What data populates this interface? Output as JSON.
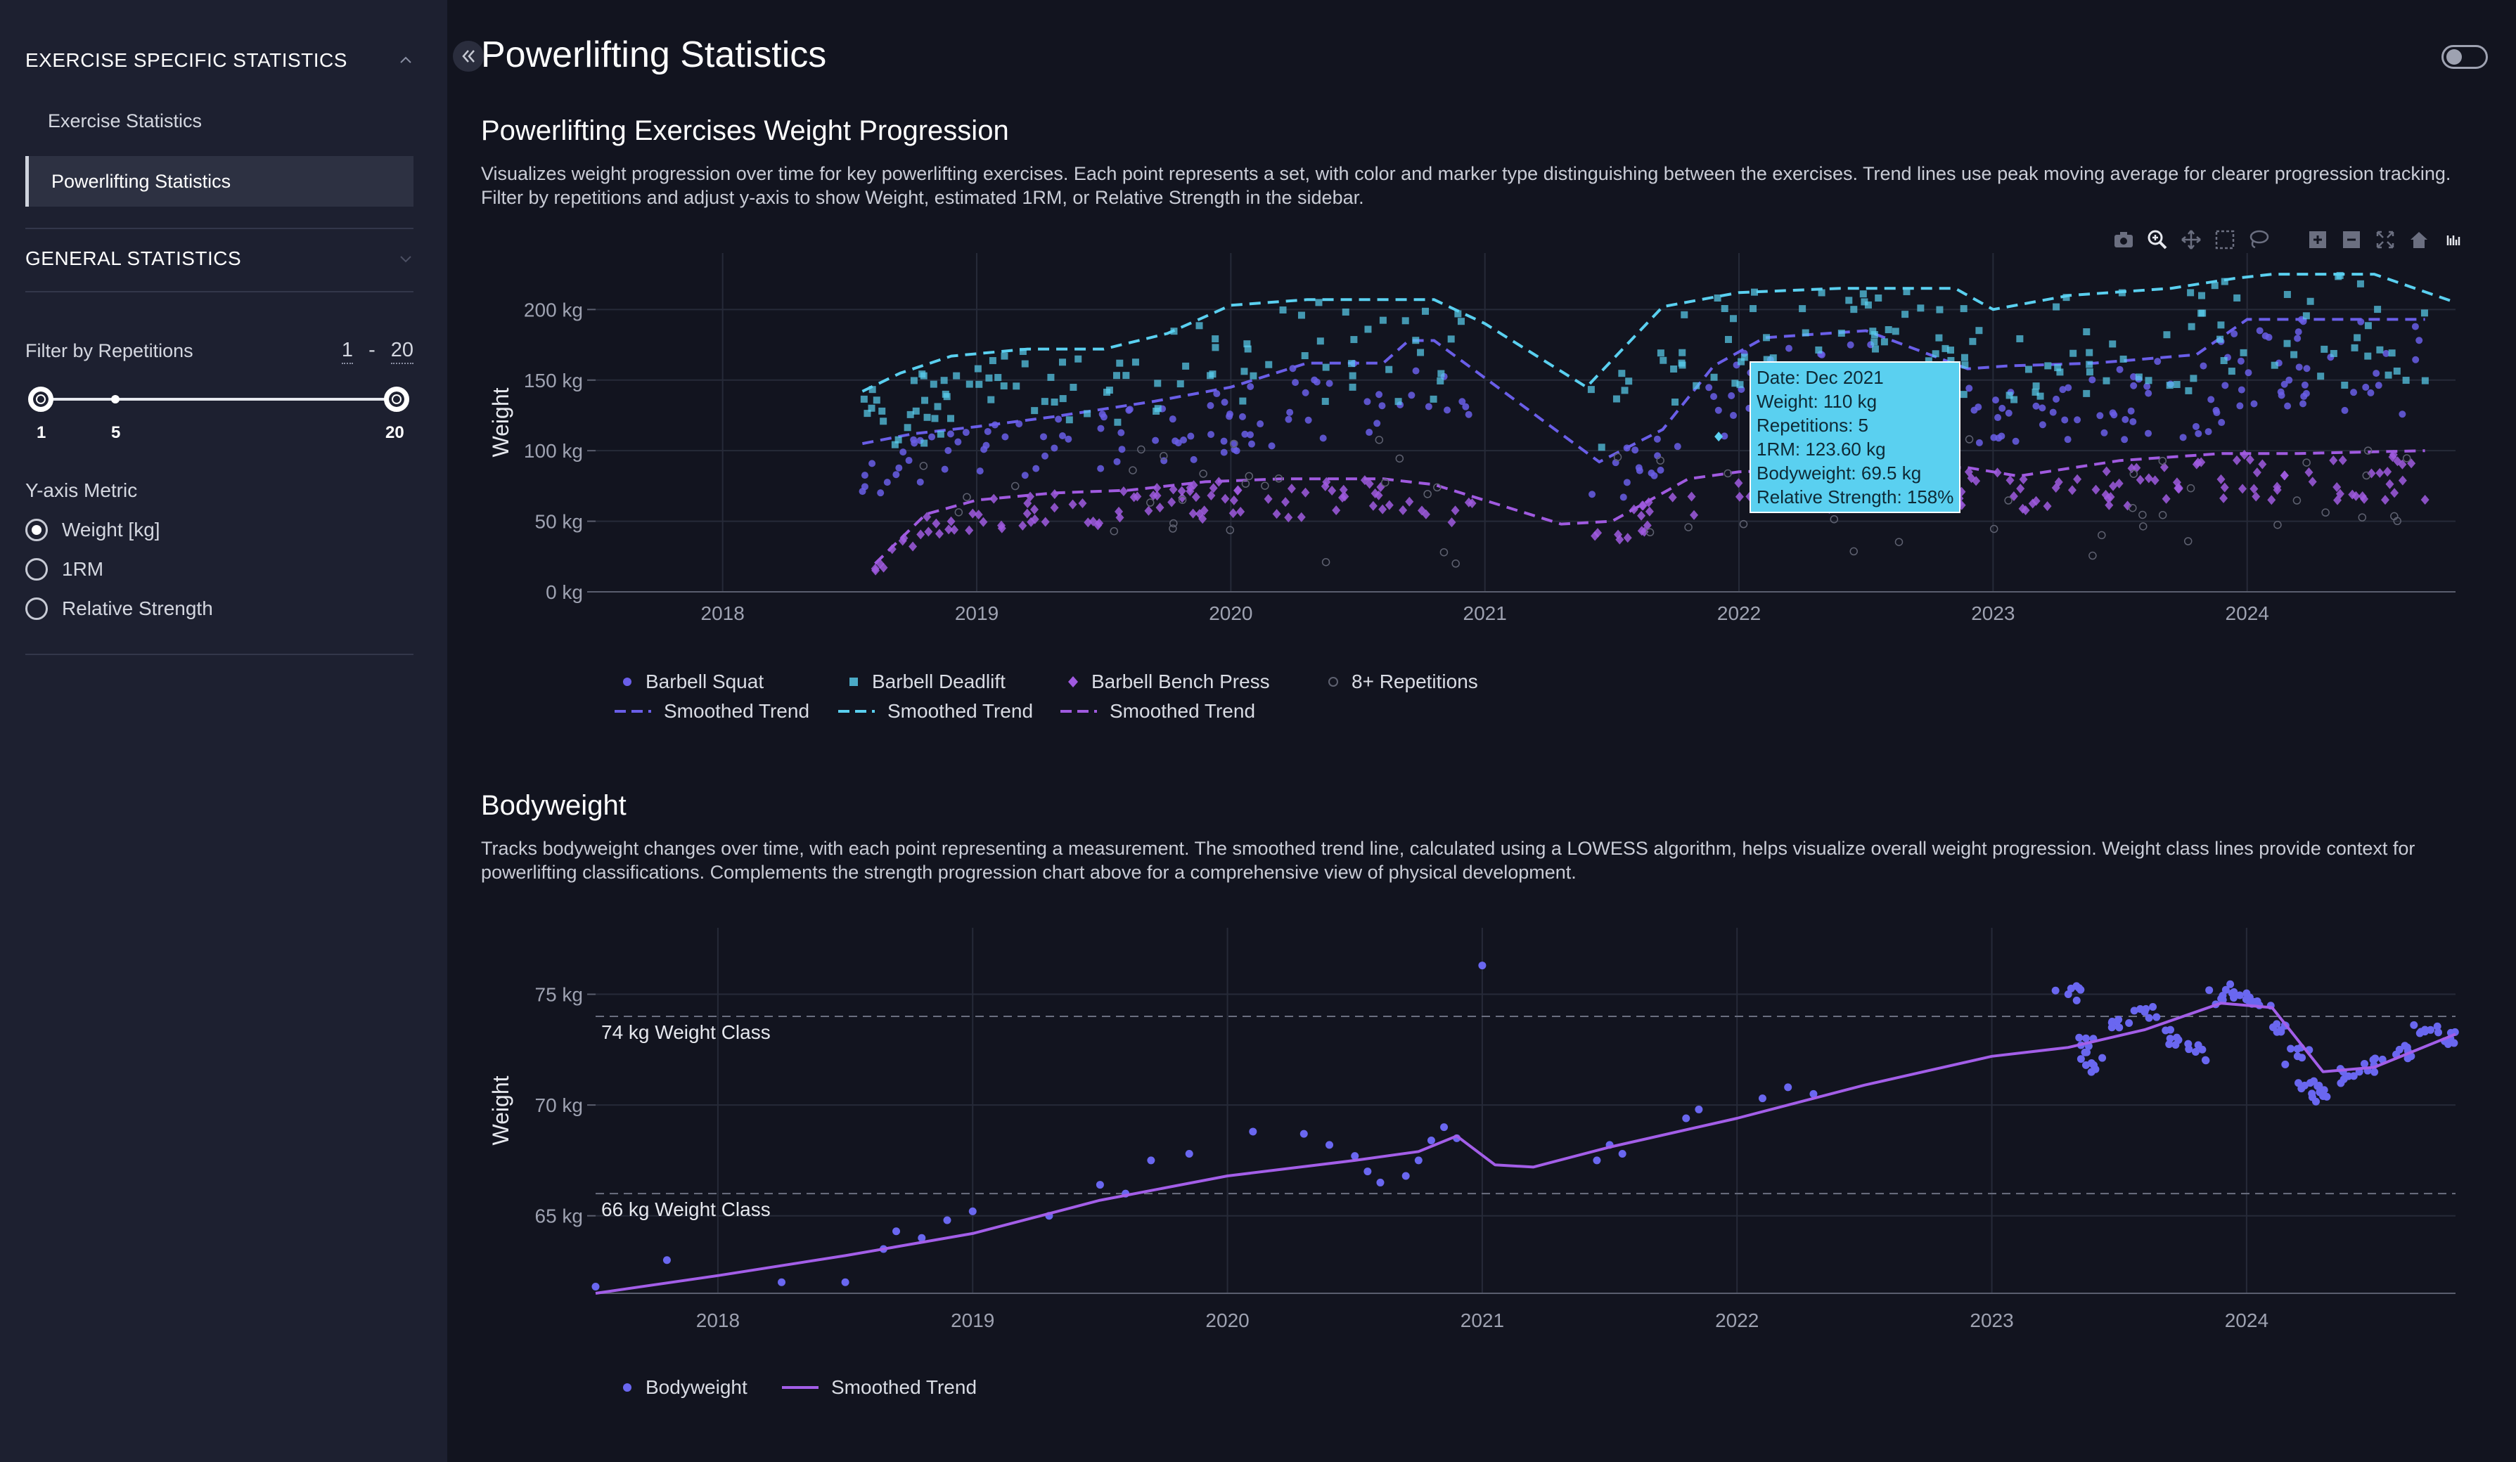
{
  "sidebar": {
    "section1_title": "EXERCISE SPECIFIC STATISTICS",
    "items": [
      {
        "label": "Exercise Statistics"
      },
      {
        "label": "Powerlifting Statistics"
      }
    ],
    "section2_title": "GENERAL STATISTICS",
    "filter_label": "Filter by Repetitions",
    "range_min": "1",
    "range_sep": "-",
    "range_max": "20",
    "slider_ticks": [
      "1",
      "5",
      "20"
    ],
    "metric_label": "Y-axis Metric",
    "metric_options": [
      "Weight [kg]",
      "1RM",
      "Relative Strength"
    ],
    "selected_metric": "Weight [kg]"
  },
  "header": {
    "collapse_icon": "double-chevron-left-icon",
    "title": "Powerlifting Statistics"
  },
  "section1": {
    "title": "Powerlifting Exercises Weight Progression",
    "description": "Visualizes weight progression over time for key powerlifting exercises. Each point represents a set, with color and marker type distinguishing between the exercises. Trend lines use peak moving average for clearer progression tracking. Filter by repetitions and adjust y-axis to show Weight, estimated 1RM, or Relative Strength in the sidebar."
  },
  "section2": {
    "title": "Bodyweight",
    "description": "Tracks bodyweight changes over time, with each point representing a measurement. The smoothed trend line, calculated using a LOWESS algorithm, helps visualize overall weight progression. Weight class lines provide context for powerlifting classifications. Complements the strength progression chart above for a comprehensive view of physical development."
  },
  "tooltip": {
    "lines": [
      "Date: Dec 2021",
      "Weight: 110 kg",
      "Repetitions: 5",
      "1RM: 123.60 kg",
      "Bodyweight: 69.5 kg",
      "Relative Strength: 158%"
    ]
  },
  "colors": {
    "squat": "#6a5ee8",
    "deadlift": "#5ad0f0",
    "bench": "#a05ae0",
    "high_reps": "#8b8e99",
    "bodyweight": "#6a67f0",
    "bw_trend": "#a35ee8",
    "background": "#12141f",
    "sidebar": "#1d2030"
  },
  "chart_data": [
    {
      "type": "scatter",
      "ylabel": "Weight",
      "ytick_labels": [
        "0 kg",
        "50 kg",
        "100 kg",
        "150 kg",
        "200 kg"
      ],
      "yticks": [
        0,
        50,
        100,
        150,
        200
      ],
      "ylim": [
        0,
        240
      ],
      "xlim": [
        2017.5,
        2024.82
      ],
      "xtick_labels": [
        "2018",
        "2019",
        "2020",
        "2021",
        "2022",
        "2023",
        "2024"
      ],
      "xticks": [
        2018,
        2019,
        2020,
        2021,
        2022,
        2023,
        2024
      ],
      "legend": [
        {
          "name": "Barbell Squat",
          "marker": "circle",
          "color": "#6a5ee8"
        },
        {
          "name": "Barbell Deadlift",
          "marker": "square",
          "color": "#5ad0f0"
        },
        {
          "name": "Barbell Bench Press",
          "marker": "diamond",
          "color": "#a05ae0"
        },
        {
          "name": "8+ Repetitions",
          "marker": "hollow-circle",
          "color": "#8b8e99"
        },
        {
          "name": "Smoothed Trend",
          "marker": "dash",
          "color": "#6a5ee8"
        },
        {
          "name": "Smoothed Trend",
          "marker": "dash",
          "color": "#5ad0f0"
        },
        {
          "name": "Smoothed Trend",
          "marker": "dash",
          "color": "#a05ae0"
        }
      ],
      "series": [
        {
          "name": "Barbell Squat",
          "trend": [
            [
              2018.55,
              105
            ],
            [
              2018.75,
              112
            ],
            [
              2019.0,
              117
            ],
            [
              2019.3,
              124
            ],
            [
              2019.7,
              135
            ],
            [
              2020.0,
              145
            ],
            [
              2020.3,
              162
            ],
            [
              2020.6,
              162
            ],
            [
              2020.7,
              178
            ],
            [
              2020.8,
              178
            ],
            [
              2021.45,
              92
            ],
            [
              2021.7,
              115
            ],
            [
              2021.9,
              160
            ],
            [
              2022.1,
              180
            ],
            [
              2022.5,
              185
            ],
            [
              2022.9,
              158
            ],
            [
              2023.05,
              160
            ],
            [
              2023.4,
              162
            ],
            [
              2023.8,
              168
            ],
            [
              2024.0,
              193
            ],
            [
              2024.7,
              193
            ]
          ]
        },
        {
          "name": "Barbell Deadlift",
          "trend": [
            [
              2018.55,
              142
            ],
            [
              2018.7,
              155
            ],
            [
              2018.9,
              167
            ],
            [
              2019.2,
              172
            ],
            [
              2019.5,
              172
            ],
            [
              2019.75,
              183
            ],
            [
              2020.0,
              203
            ],
            [
              2020.3,
              207
            ],
            [
              2020.55,
              207
            ],
            [
              2020.7,
              207
            ],
            [
              2020.8,
              207
            ],
            [
              2021.0,
              190
            ],
            [
              2021.4,
              145
            ],
            [
              2021.7,
              202
            ],
            [
              2022.0,
              212
            ],
            [
              2022.4,
              215
            ],
            [
              2022.85,
              215
            ],
            [
              2023.0,
              200
            ],
            [
              2023.3,
              210
            ],
            [
              2023.7,
              215
            ],
            [
              2023.95,
              222
            ],
            [
              2024.1,
              225
            ],
            [
              2024.5,
              225
            ],
            [
              2024.82,
              205
            ]
          ]
        },
        {
          "name": "Barbell Bench Press",
          "trend": [
            [
              2018.6,
              20
            ],
            [
              2018.8,
              55
            ],
            [
              2019.0,
              65
            ],
            [
              2019.3,
              70
            ],
            [
              2019.6,
              72
            ],
            [
              2019.9,
              78
            ],
            [
              2020.2,
              80
            ],
            [
              2020.6,
              80
            ],
            [
              2020.8,
              76
            ],
            [
              2021.3,
              48
            ],
            [
              2021.5,
              50
            ],
            [
              2021.8,
              80
            ],
            [
              2022.0,
              85
            ],
            [
              2022.5,
              88
            ],
            [
              2022.9,
              88
            ],
            [
              2023.1,
              82
            ],
            [
              2023.5,
              93
            ],
            [
              2023.9,
              98
            ],
            [
              2024.2,
              98
            ],
            [
              2024.7,
              100
            ]
          ]
        }
      ],
      "highlight": {
        "x": 2021.92,
        "y": 110
      }
    },
    {
      "type": "scatter",
      "ylabel": "Weight",
      "ytick_labels": [
        "65 kg",
        "70 kg",
        "75 kg"
      ],
      "yticks": [
        65,
        70,
        75
      ],
      "ylim": [
        61.5,
        78
      ],
      "xlim": [
        2017.52,
        2024.82
      ],
      "xtick_labels": [
        "2018",
        "2019",
        "2020",
        "2021",
        "2022",
        "2023",
        "2024"
      ],
      "xticks": [
        2018,
        2019,
        2020,
        2021,
        2022,
        2023,
        2024
      ],
      "reference_lines": [
        {
          "y": 74,
          "label": "74 kg Weight Class"
        },
        {
          "y": 66,
          "label": "66 kg Weight Class"
        }
      ],
      "legend": [
        {
          "name": "Bodyweight",
          "marker": "circle",
          "color": "#6a67f0"
        },
        {
          "name": "Smoothed Trend",
          "marker": "line",
          "color": "#a35ee8"
        }
      ],
      "series": [
        {
          "name": "Smoothed Trend",
          "values": [
            [
              2017.52,
              61.5
            ],
            [
              2018.0,
              62.3
            ],
            [
              2018.5,
              63.2
            ],
            [
              2019.0,
              64.2
            ],
            [
              2019.5,
              65.7
            ],
            [
              2020.0,
              66.8
            ],
            [
              2020.5,
              67.5
            ],
            [
              2020.75,
              67.9
            ],
            [
              2020.9,
              68.6
            ],
            [
              2021.05,
              67.3
            ],
            [
              2021.2,
              67.2
            ],
            [
              2021.5,
              68.1
            ],
            [
              2022.0,
              69.4
            ],
            [
              2022.5,
              70.9
            ],
            [
              2023.0,
              72.2
            ],
            [
              2023.3,
              72.6
            ],
            [
              2023.6,
              73.4
            ],
            [
              2023.9,
              74.6
            ],
            [
              2024.1,
              74.4
            ],
            [
              2024.3,
              71.5
            ],
            [
              2024.5,
              71.7
            ],
            [
              2024.82,
              73.2
            ]
          ]
        },
        {
          "name": "Bodyweight",
          "values": [
            [
              2017.52,
              61.8
            ],
            [
              2017.8,
              63.0
            ],
            [
              2018.25,
              62.0
            ],
            [
              2018.5,
              62.0
            ],
            [
              2018.65,
              63.5
            ],
            [
              2018.7,
              64.3
            ],
            [
              2018.8,
              64.0
            ],
            [
              2018.9,
              64.8
            ],
            [
              2019.0,
              65.2
            ],
            [
              2019.3,
              65.0
            ],
            [
              2019.5,
              66.4
            ],
            [
              2019.6,
              66.0
            ],
            [
              2019.7,
              67.5
            ],
            [
              2019.85,
              67.8
            ],
            [
              2020.1,
              68.8
            ],
            [
              2020.3,
              68.7
            ],
            [
              2020.4,
              68.2
            ],
            [
              2020.5,
              67.7
            ],
            [
              2020.55,
              67.0
            ],
            [
              2020.6,
              66.5
            ],
            [
              2020.7,
              66.8
            ],
            [
              2020.75,
              67.5
            ],
            [
              2020.8,
              68.4
            ],
            [
              2020.85,
              69.0
            ],
            [
              2020.9,
              68.5
            ],
            [
              2021.0,
              76.3
            ],
            [
              2021.45,
              67.5
            ],
            [
              2021.5,
              68.2
            ],
            [
              2021.55,
              67.8
            ],
            [
              2021.8,
              69.4
            ],
            [
              2021.85,
              69.8
            ],
            [
              2022.1,
              70.3
            ],
            [
              2022.2,
              70.8
            ],
            [
              2022.3,
              70.5
            ],
            [
              2023.3,
              75.0
            ],
            [
              2023.35,
              72.7
            ],
            [
              2023.4,
              71.8
            ],
            [
              2023.5,
              73.5
            ],
            [
              2023.6,
              74.2
            ],
            [
              2023.7,
              73.0
            ],
            [
              2023.8,
              72.4
            ],
            [
              2023.9,
              74.8
            ],
            [
              2023.95,
              75.1
            ],
            [
              2024.05,
              74.5
            ],
            [
              2024.15,
              73.6
            ],
            [
              2024.2,
              72.2
            ],
            [
              2024.25,
              71.0
            ],
            [
              2024.3,
              70.4
            ],
            [
              2024.4,
              71.3
            ],
            [
              2024.5,
              71.8
            ],
            [
              2024.6,
              72.5
            ],
            [
              2024.7,
              73.4
            ],
            [
              2024.8,
              73.0
            ]
          ]
        }
      ]
    }
  ]
}
